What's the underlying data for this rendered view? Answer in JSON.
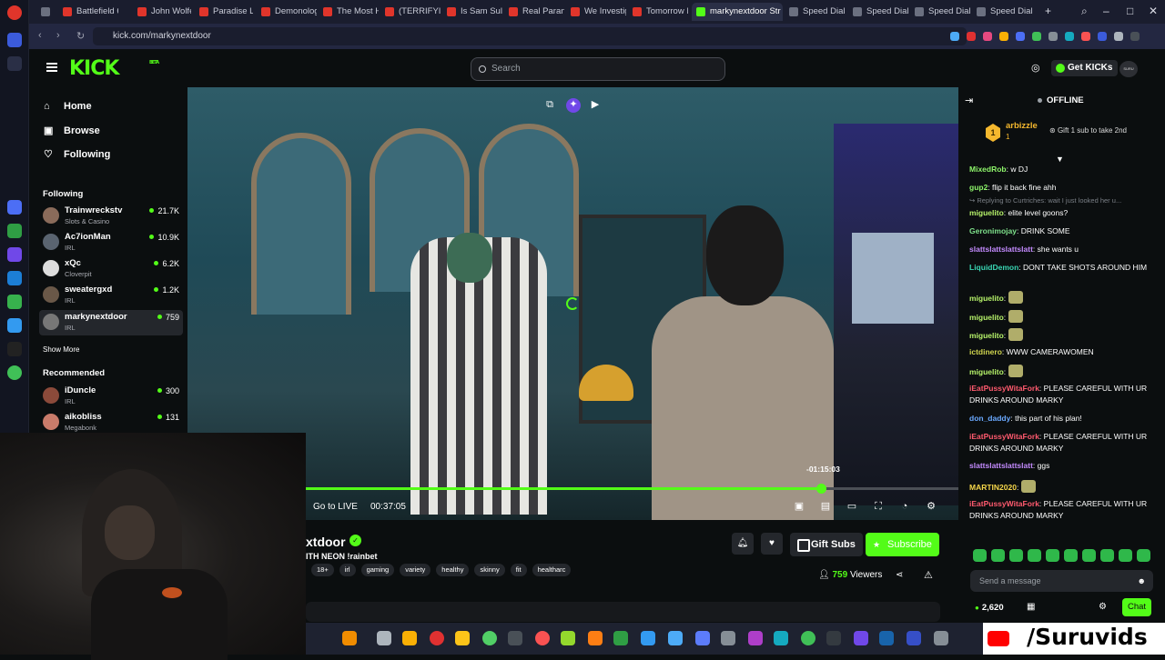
{
  "browser": {
    "tabs": [
      {
        "label": "Battlefield 6 -",
        "active": false
      },
      {
        "label": "John Wolfe -",
        "active": false
      },
      {
        "label": "Paradise Lost",
        "active": false
      },
      {
        "label": "Demonologis",
        "active": false
      },
      {
        "label": "The Most Ha",
        "active": false
      },
      {
        "label": "(TERRIFYING)",
        "active": false
      },
      {
        "label": "Is Sam Sulek",
        "active": false
      },
      {
        "label": "Real Paranorm",
        "active": false
      },
      {
        "label": "We Investigat",
        "active": false
      },
      {
        "label": "Tomorrow Is",
        "active": false
      },
      {
        "label": "markynextdoor Str",
        "active": true
      },
      {
        "label": "Speed Dial",
        "active": false
      },
      {
        "label": "Speed Dial",
        "active": false
      },
      {
        "label": "Speed Dial",
        "active": false
      },
      {
        "label": "Speed Dial",
        "active": false
      }
    ],
    "url": "kick.com/markynextdoor"
  },
  "header": {
    "logo": "KICK",
    "logo_sup": "BETA",
    "search_placeholder": "Search",
    "get_kicks": "Get KICKs",
    "avatar": "SURU"
  },
  "sidebar": {
    "nav": [
      {
        "label": "Home",
        "icon": "home-icon"
      },
      {
        "label": "Browse",
        "icon": "browse-icon"
      },
      {
        "label": "Following",
        "icon": "heart-icon"
      }
    ],
    "following_title": "Following",
    "following": [
      {
        "name": "Trainwreckstv",
        "category": "Slots & Casino",
        "viewers": "21.7K"
      },
      {
        "name": "Ac7ionMan",
        "category": "IRL",
        "viewers": "10.9K"
      },
      {
        "name": "xQc",
        "category": "Cloverpit",
        "viewers": "6.2K"
      },
      {
        "name": "sweatergxd",
        "category": "IRL",
        "viewers": "1.2K"
      },
      {
        "name": "markynextdoor",
        "category": "IRL",
        "viewers": "759"
      }
    ],
    "show_more": "Show More",
    "recommended_title": "Recommended",
    "recommended": [
      {
        "name": "iDuncle",
        "category": "IRL",
        "viewers": "300"
      },
      {
        "name": "aikobliss",
        "category": "Megabonk",
        "viewers": "131"
      }
    ]
  },
  "player": {
    "go_live": "Go to LIVE",
    "timecode": "00:37:05",
    "tooltip": "-01:15:03",
    "progress": 0.79
  },
  "channel": {
    "name": "xtdoor",
    "title": "ITH NEON !rainbet",
    "tags": [
      "18+",
      "irl",
      "gaming",
      "variety",
      "healthy",
      "skinny",
      "fit",
      "healtharc"
    ],
    "gift_subs": "Gift Subs",
    "subscribe": "Subscribe",
    "viewers_count": "759",
    "viewers_label": "Viewers"
  },
  "chat": {
    "status": "OFFLINE",
    "pinned": {
      "rank": "1",
      "name": "arbizzle",
      "count": "1",
      "gift": "Gift 1 sub to take 2nd"
    },
    "messages": [
      {
        "user": "MixedRob",
        "color": "#8ef56b",
        "text": "w DJ"
      },
      {
        "user": "gup2",
        "color": "#8ef56b",
        "text": "flip it back fine ahh"
      },
      {
        "reply": "Replying to Curtriches: wait I just looked her u..."
      },
      {
        "user": "miguelito",
        "color": "#b6f26a",
        "text": "elite level goons?"
      },
      {
        "user": "Geronimojay",
        "color": "#7ee08b",
        "text": "DRINK SOME"
      },
      {
        "user": "slattslattslattslatt",
        "color": "#c48bff",
        "text": "she wants u"
      },
      {
        "user": "LiquidDemon",
        "color": "#39d6b3",
        "text": "DONT TAKE SHOTS AROUND HIM"
      },
      {
        "user": "miguelito",
        "color": "#b6f26a",
        "text": ""
      },
      {
        "user": "miguelito",
        "color": "#b6f26a",
        "text": ""
      },
      {
        "user": "miguelito",
        "color": "#b6f26a",
        "text": ""
      },
      {
        "user": "ictdinero",
        "color": "#d1d64f",
        "text": "WWW CAMERAWOMEN"
      },
      {
        "user": "miguelito",
        "color": "#b6f26a",
        "text": ""
      },
      {
        "user": "iEatPussyWitaFork",
        "color": "#ff5a6e",
        "text": "PLEASE CAREFUL WITH UR DRINKS AROUND MARKY"
      },
      {
        "user": "don_daddy",
        "color": "#6aa9ff",
        "text": "this part of his plan!"
      },
      {
        "user": "iEatPussyWitaFork",
        "color": "#ff5a6e",
        "text": "PLEASE CAREFUL WITH UR DRINKS AROUND MARKY"
      },
      {
        "user": "slattslattslattslatt",
        "color": "#c48bff",
        "text": "ggs"
      },
      {
        "user": "MARTIN2020",
        "color": "#f5d64a",
        "text": ""
      },
      {
        "user": "iEatPussyWitaFork",
        "color": "#ff5a6e",
        "text": "PLEASE CAREFUL WITH UR DRINKS AROUND MARKY"
      }
    ],
    "input_placeholder": "Send a message",
    "points": "2,620",
    "chat_button": "Chat"
  },
  "branding": "/Suruvids",
  "colors": {
    "accent": "#53fc18",
    "background": "#0b0e0f",
    "surface": "#24272c"
  }
}
